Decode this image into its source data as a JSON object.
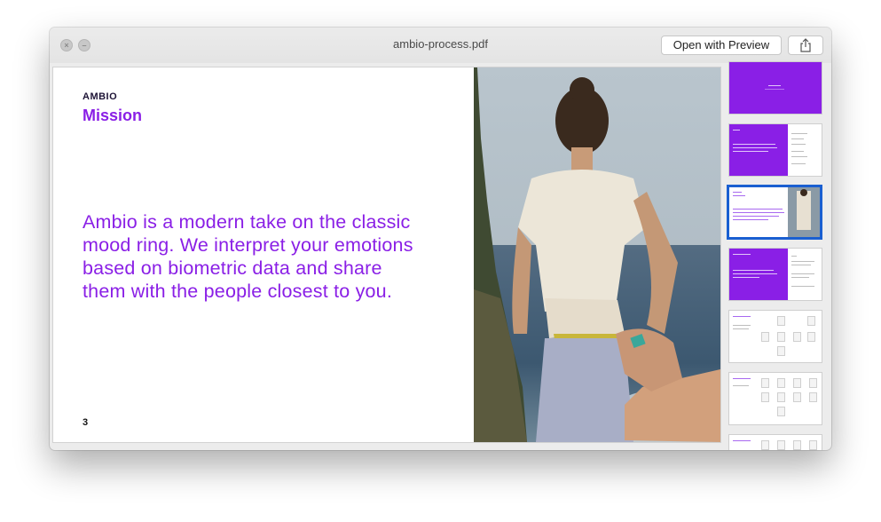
{
  "window": {
    "title": "ambio-process.pdf",
    "open_with_label": "Open with Preview"
  },
  "slide": {
    "brand": "AMBIO",
    "title": "Mission",
    "body": "Ambio is a modern take on the classic mood ring. We interpret your emotions based on biometric data and share them with the people closest to you.",
    "page_number": "3"
  },
  "thumbnails": {
    "selected_index": 2
  },
  "colors": {
    "accent": "#8a1fe6",
    "selection": "#1a5fd1",
    "titlebar": "#e8e8e8"
  },
  "icons": [
    "close-icon",
    "minimize-icon",
    "share-icon"
  ]
}
